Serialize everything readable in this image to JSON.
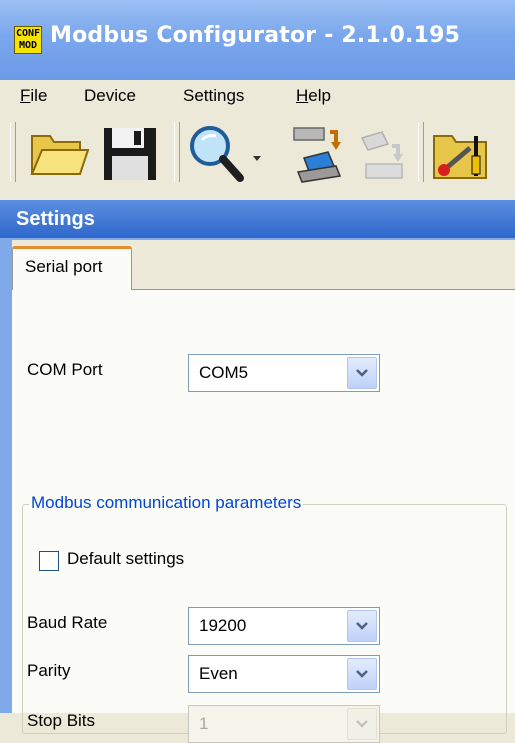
{
  "window": {
    "title": "Modbus Configurator - 2.1.0.195",
    "logo_text_top": "CONF",
    "logo_text_bottom": "MOD"
  },
  "menu": {
    "items": [
      {
        "label": "File",
        "mnemonic": "F"
      },
      {
        "label": "Device"
      },
      {
        "label": "Settings"
      },
      {
        "label": "Help",
        "mnemonic": "H"
      }
    ]
  },
  "toolbar": {
    "buttons": [
      {
        "icon": "open-folder-icon"
      },
      {
        "icon": "save-disk-icon"
      },
      {
        "icon": "search-magnifier-icon"
      },
      {
        "icon": "download-to-device-icon"
      },
      {
        "icon": "upload-from-device-icon"
      },
      {
        "icon": "configure-tools-icon"
      }
    ]
  },
  "settings_panel": {
    "title": "Settings",
    "tab_label": "Serial port",
    "com_port": {
      "label": "COM Port",
      "value": "COM5"
    },
    "group": {
      "legend": "Modbus communication parameters",
      "default_settings": {
        "label": "Default settings",
        "checked": false
      },
      "baud_rate": {
        "label": "Baud Rate",
        "value": "19200"
      },
      "parity": {
        "label": "Parity",
        "value": "Even"
      },
      "stop_bits": {
        "label": "Stop Bits",
        "value": "1",
        "enabled": false
      }
    }
  },
  "colors": {
    "title_bar": "#7aa7ec",
    "panel_header": "#2e67cc",
    "group_legend": "#0046d5",
    "tab_highlight": "#e68b2c"
  }
}
